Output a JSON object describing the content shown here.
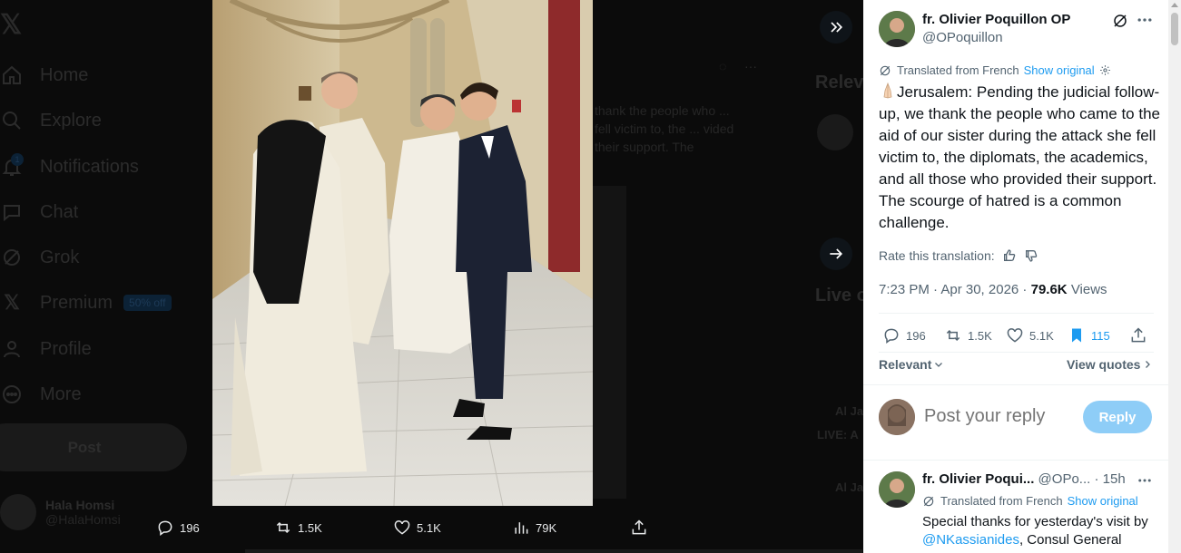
{
  "background": {
    "nav": {
      "items": [
        {
          "label": "Home",
          "icon": "home-icon"
        },
        {
          "label": "Explore",
          "icon": "search-icon"
        },
        {
          "label": "Notifications",
          "icon": "bell-icon"
        },
        {
          "label": "Chat",
          "icon": "chat-icon"
        },
        {
          "label": "Grok",
          "icon": "grok-icon"
        },
        {
          "label": "Premium",
          "icon": "x-logo-icon",
          "badge": "50% off"
        },
        {
          "label": "Profile",
          "icon": "person-icon"
        },
        {
          "label": "More",
          "icon": "more-circle-icon"
        }
      ],
      "post_button": "Post",
      "user_name": "Hala Homsi",
      "user_handle": "@HalaHomsi"
    },
    "feed_snippet": "thank the people who ... fell victim to, the ... vided their support. The",
    "right_titles": [
      "Relev",
      "Live o"
    ],
    "right_snippets": [
      "Al Ja",
      "LIVE: A",
      "Al Ja"
    ]
  },
  "media_actions": {
    "replies": "196",
    "reposts": "1.5K",
    "likes": "5.1K",
    "views": "79K"
  },
  "tweet": {
    "author_name": "fr. Olivier Poquillon OP",
    "author_handle": "@OPoquillon",
    "translated_label": "Translated from French",
    "show_original": "Show original",
    "text": "Jerusalem: Pending the judicial follow-up, we thank the people who came to the aid of our sister during the attack she fell victim to, the diplomats, the academics, and all those who provided their support. The scourge of hatred is a common challenge.",
    "rate_label": "Rate this translation:",
    "time": "7:23 PM · Apr 30, 2026",
    "views_count": "79.6K",
    "views_label": "Views",
    "stats": {
      "replies": "196",
      "reposts": "1.5K",
      "likes": "5.1K",
      "bookmarks": "115"
    },
    "relevant_label": "Relevant",
    "view_quotes_label": "View quotes"
  },
  "reply_box": {
    "placeholder": "Post your reply",
    "button": "Reply"
  },
  "reply_tweet": {
    "author_name": "fr. Olivier Poqui...",
    "author_handle": "@OPo...",
    "time": "· 15h",
    "translated_label": "Translated from French",
    "show_original": "Show original",
    "text_before": "Special thanks for yesterday's visit by ",
    "mention": "@NKassianides",
    "text_after": ", Consul General"
  },
  "colors": {
    "accent": "#1d9bf0",
    "reply_button_disabled": "#8ecdf7",
    "text_primary": "#0f1419",
    "text_secondary": "#536471"
  }
}
